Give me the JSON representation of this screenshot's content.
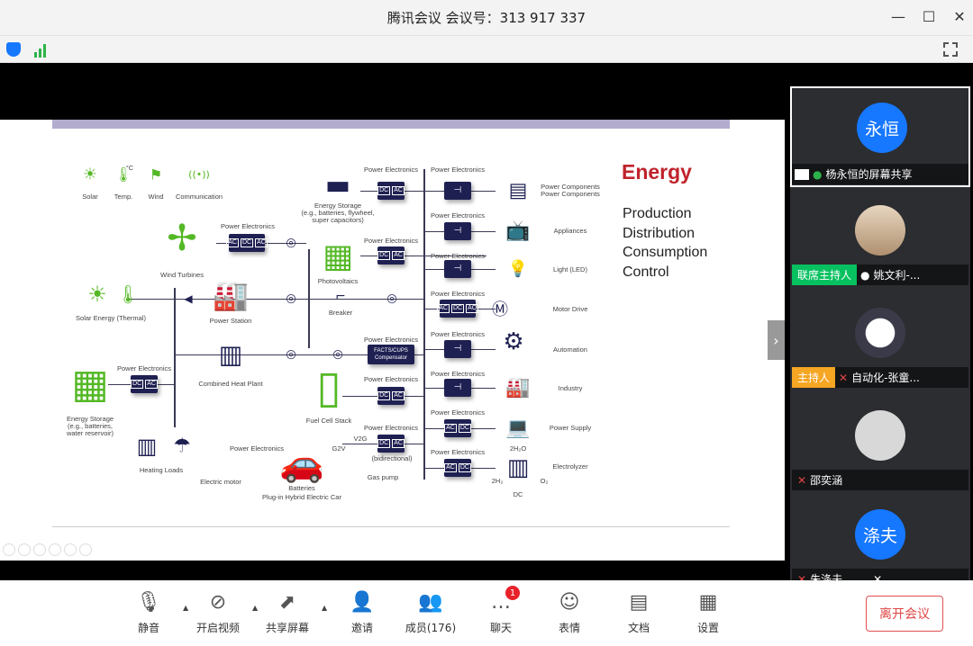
{
  "window": {
    "title": "腾讯会议 会议号：313 917 337",
    "minimize": "—",
    "maximize": "☐",
    "close": "✕"
  },
  "colors": {
    "accent_blue": "#1677ff",
    "cohost": "#07c160",
    "host": "#f5a623",
    "leave": "#e04545",
    "slide_title": "#c0232c",
    "converter_box": "#1f2052",
    "green_icon": "#54b825"
  },
  "slide": {
    "title": "Energy",
    "topics": [
      "Production",
      "Distribution",
      "Consumption",
      "Control"
    ],
    "labels": [
      "Solar",
      "Temp.",
      "Wind",
      "Communication",
      "Energy Storage",
      "(e.g., batteries, flywheel,",
      "super capacitors)",
      "Power Electronics",
      "Wind Turbines",
      "Photovoltaics",
      "Solar Energy (Thermal)",
      "Power Station",
      "Breaker",
      "Combined Heat Plant",
      "Energy Storage",
      "(e.g., batteries,",
      "water reservoir)",
      "Heating Loads",
      "Electric motor",
      "Batteries",
      "Plug-in Hybrid Electric Car",
      "Fuel Cell Stack",
      "G2V",
      "V2G",
      "Gas pump",
      "(bidirectional)",
      "Power Components",
      "Appliances",
      "Light (LED)",
      "Motor Drive",
      "Automation",
      "Industry",
      "Power Supply",
      "Electrolyzer",
      "2H₂O",
      "2H₂",
      "O₂",
      "DC",
      "°C",
      "M"
    ],
    "converters": {
      "dc_ac": [
        "DC",
        "AC"
      ],
      "ac_dc_ac": [
        "AC",
        "DC",
        "AC"
      ],
      "ac_dc": [
        "AC",
        "DC"
      ],
      "facts": "FACTS/CUPS Compensator"
    }
  },
  "participants": [
    {
      "avatar_text": "永恒",
      "name": "杨永恒的屏幕共享",
      "role": "",
      "mic": "on",
      "sharing": true
    },
    {
      "avatar_text": "",
      "name": "姚文利-...",
      "role": "联席主持人",
      "mic": "on"
    },
    {
      "avatar_text": "",
      "name": "自动化-张童...",
      "role": "主持人",
      "mic": "muted"
    },
    {
      "avatar_text": "",
      "name": "邵奕涵",
      "role": "",
      "mic": "muted"
    },
    {
      "avatar_text": "涤夫",
      "name": "朱涤夫",
      "role": "",
      "mic": "muted"
    }
  ],
  "toolbar": {
    "items": [
      {
        "label": "静音",
        "icon": "microphone-icon"
      },
      {
        "label": "开启视频",
        "icon": "video-off-icon"
      },
      {
        "label": "共享屏幕",
        "icon": "share-screen-icon"
      },
      {
        "label": "邀请",
        "icon": "invite-user-icon"
      },
      {
        "label": "成员(176)",
        "icon": "members-icon"
      },
      {
        "label": "聊天",
        "icon": "chat-icon",
        "badge": "1"
      },
      {
        "label": "表情",
        "icon": "emoji-icon"
      },
      {
        "label": "文档",
        "icon": "document-icon"
      },
      {
        "label": "设置",
        "icon": "settings-icon"
      }
    ],
    "leave": "离开会议"
  }
}
